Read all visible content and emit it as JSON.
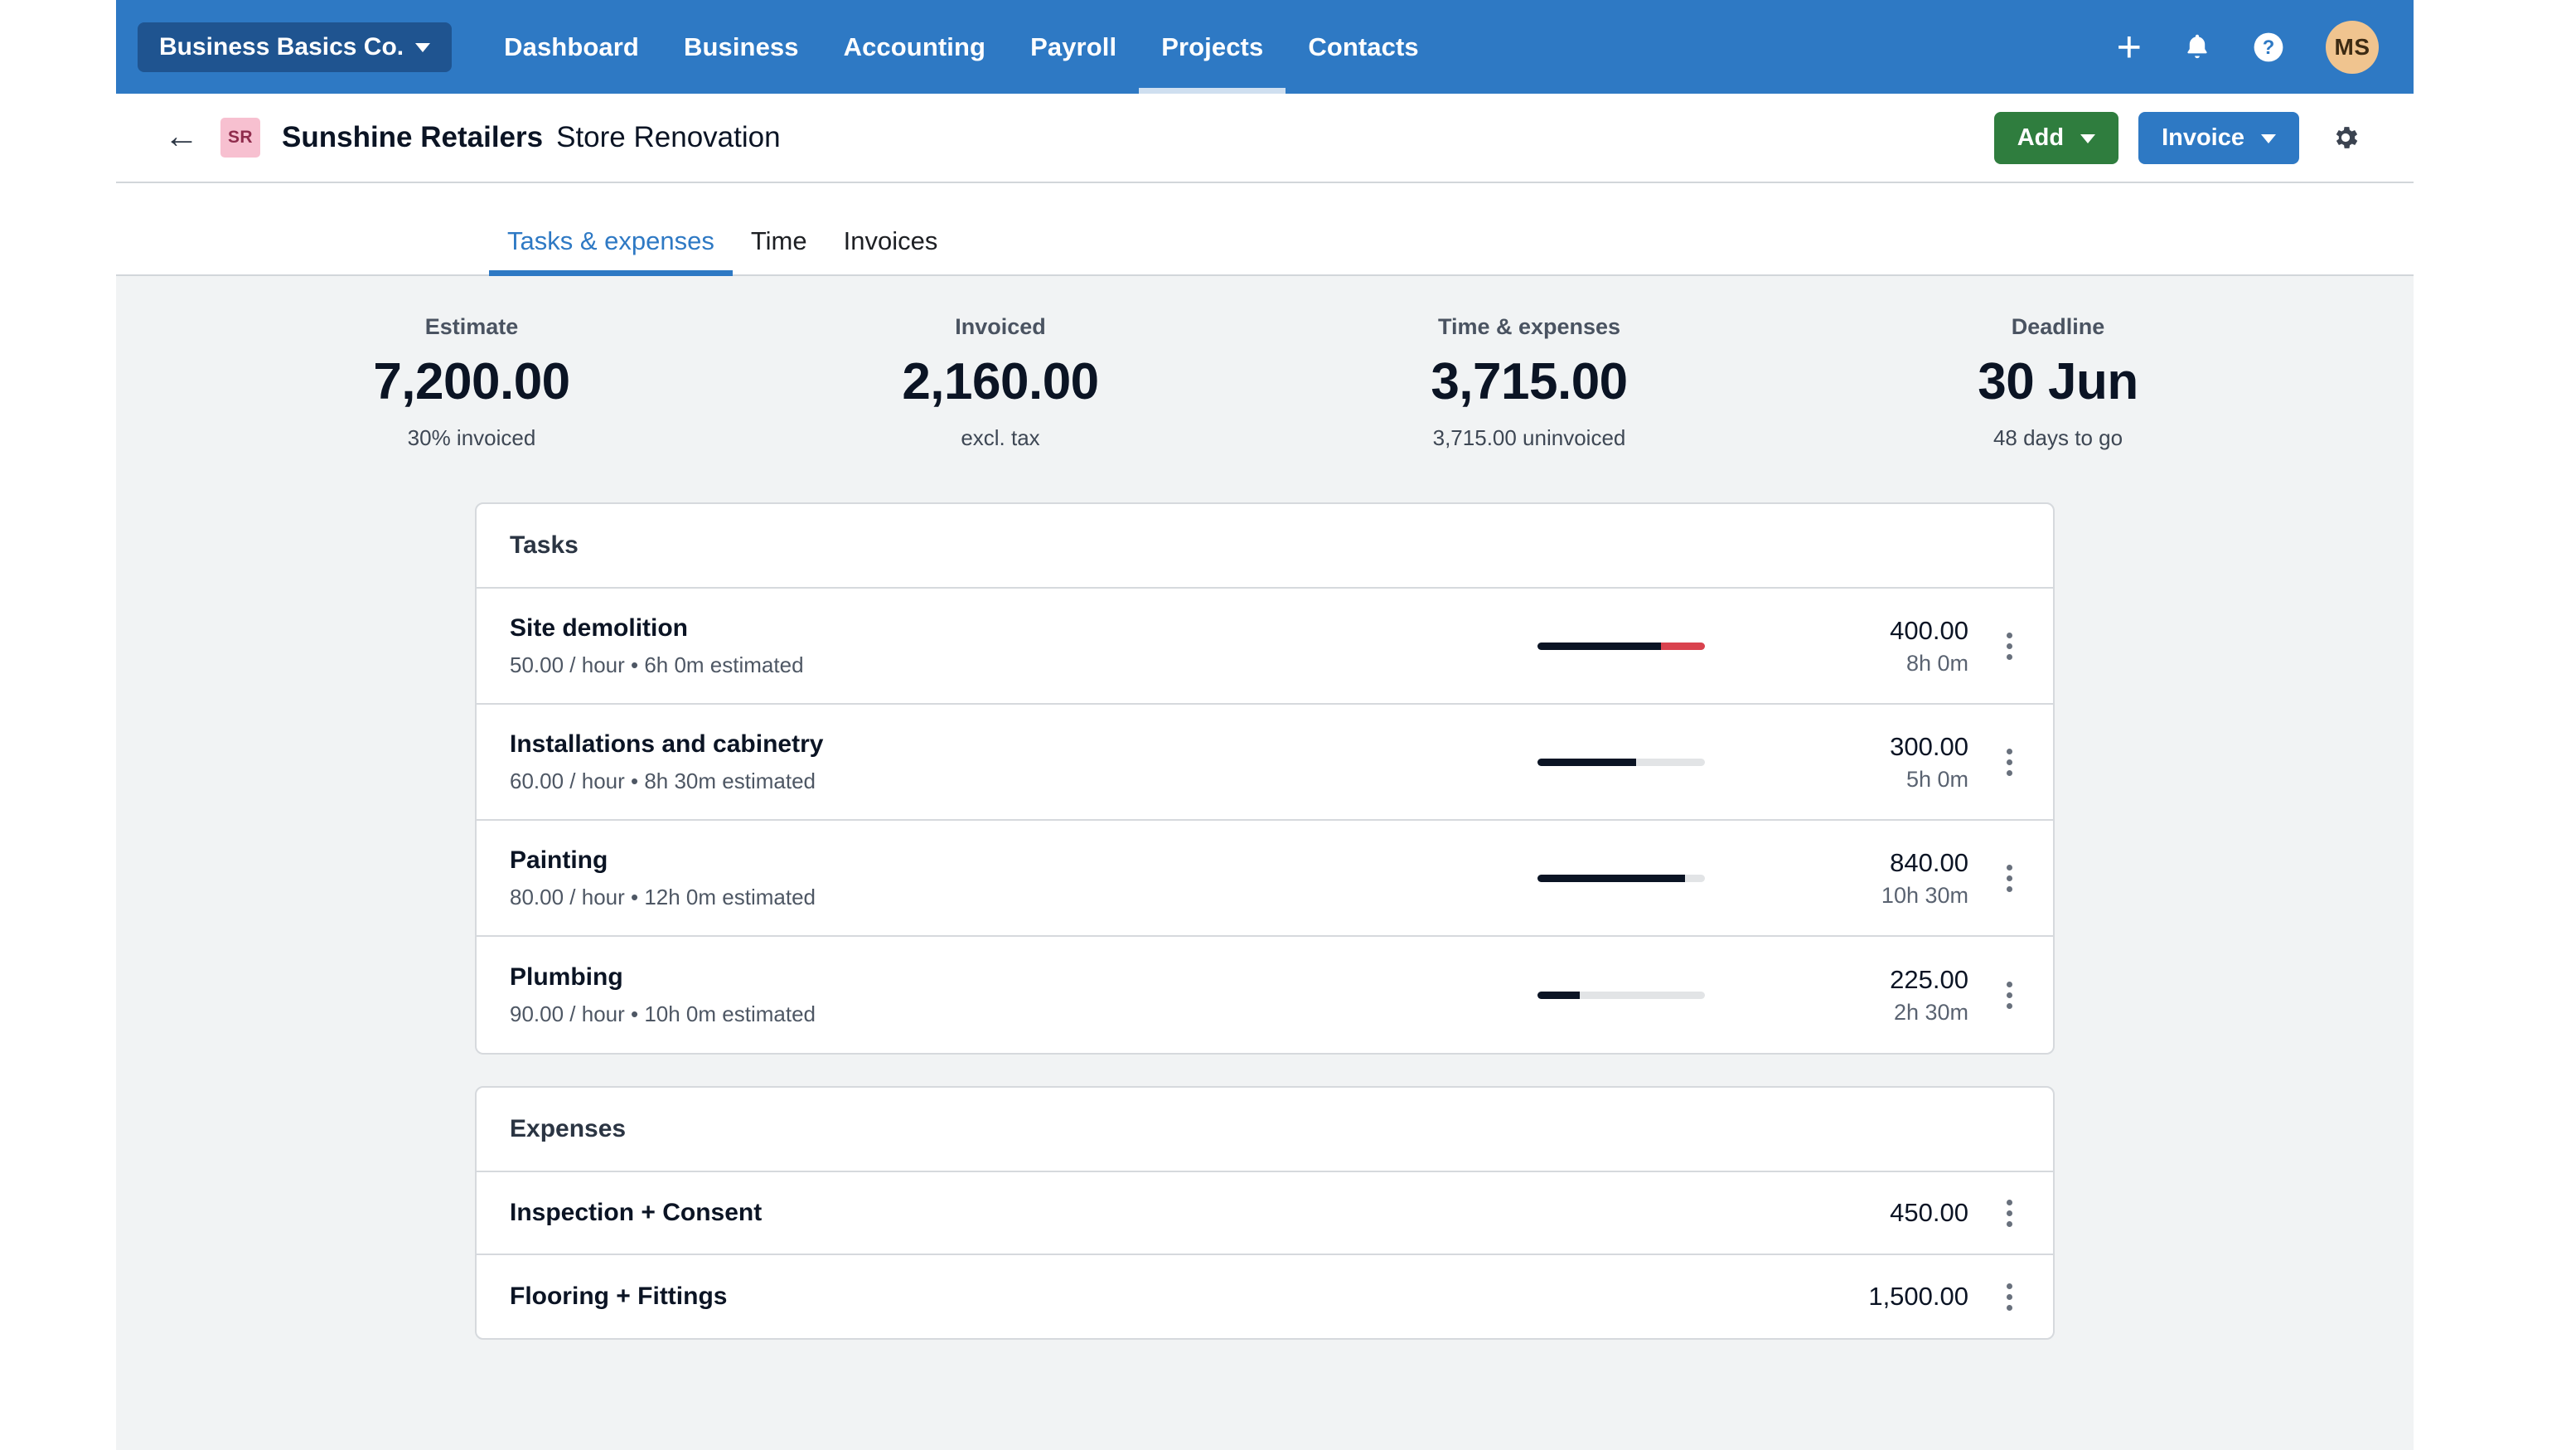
{
  "topnav": {
    "org": {
      "label": "Business Basics Co.",
      "caret": "chevron-down-icon"
    },
    "links": [
      {
        "label": "Dashboard",
        "active": false
      },
      {
        "label": "Business",
        "active": false
      },
      {
        "label": "Accounting",
        "active": false
      },
      {
        "label": "Payroll",
        "active": false
      },
      {
        "label": "Projects",
        "active": true
      },
      {
        "label": "Contacts",
        "active": false
      }
    ],
    "icons": [
      "plus-icon",
      "bell-icon",
      "help-icon"
    ],
    "avatar_initials": "MS",
    "colors": {
      "bar": "#2e79c4",
      "org_chip": "#1f5490",
      "avatar": "#f0c48f"
    }
  },
  "project_header": {
    "back": "back-arrow-icon",
    "badge_initials": "SR",
    "client": "Sunshine Retailers",
    "project": "Store Renovation",
    "add_label": "Add",
    "invoice_label": "Invoice",
    "settings_icon": "gear-icon",
    "colors": {
      "add": "#2f7d3e",
      "invoice": "#2e79c4",
      "badge_bg": "#f7c0d0"
    }
  },
  "tabs": [
    {
      "label": "Tasks & expenses",
      "active": true
    },
    {
      "label": "Time",
      "active": false
    },
    {
      "label": "Invoices",
      "active": false
    }
  ],
  "stats": [
    {
      "label": "Estimate",
      "value": "7,200.00",
      "sub": "30% invoiced"
    },
    {
      "label": "Invoiced",
      "value": "2,160.00",
      "sub": "excl. tax"
    },
    {
      "label": "Time & expenses",
      "value": "3,715.00",
      "sub": "3,715.00 uninvoiced"
    },
    {
      "label": "Deadline",
      "value": "30 Jun",
      "sub": "48 days to go"
    }
  ],
  "tasks": {
    "title": "Tasks",
    "items": [
      {
        "name": "Site demolition",
        "detail": "50.00 / hour • 6h 0m estimated",
        "amount": "400.00",
        "hours": "8h 0m",
        "progress_pct": 74,
        "over_pct": 26,
        "menu": "kebab-menu-icon"
      },
      {
        "name": "Installations and cabinetry",
        "detail": "60.00 / hour • 8h 30m estimated",
        "amount": "300.00",
        "hours": "5h 0m",
        "progress_pct": 59,
        "over_pct": 0,
        "menu": "kebab-menu-icon"
      },
      {
        "name": "Painting",
        "detail": "80.00 / hour • 12h 0m estimated",
        "amount": "840.00",
        "hours": "10h 30m",
        "progress_pct": 88,
        "over_pct": 0,
        "menu": "kebab-menu-icon"
      },
      {
        "name": "Plumbing",
        "detail": "90.00 / hour • 10h 0m estimated",
        "amount": "225.00",
        "hours": "2h 30m",
        "progress_pct": 25,
        "over_pct": 0,
        "menu": "kebab-menu-icon"
      }
    ]
  },
  "expenses": {
    "title": "Expenses",
    "items": [
      {
        "name": "Inspection + Consent",
        "amount": "450.00",
        "menu": "kebab-menu-icon"
      },
      {
        "name": "Flooring + Fittings",
        "amount": "1,500.00",
        "menu": "kebab-menu-icon"
      }
    ]
  },
  "colors": {
    "accent_blue": "#2e79c4",
    "progress_fill": "#0b1424",
    "progress_over": "#d9424e",
    "page_bg": "#f1f3f4"
  }
}
